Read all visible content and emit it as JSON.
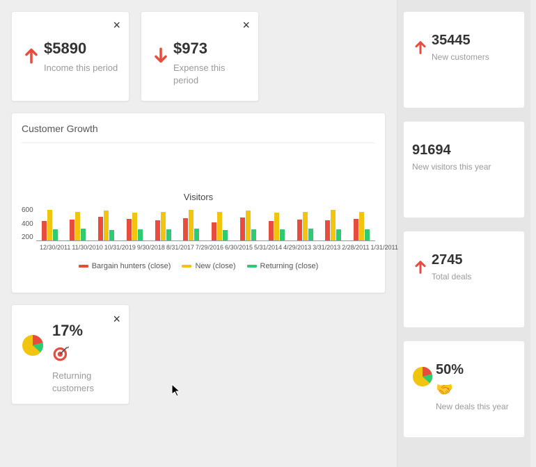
{
  "top_cards": {
    "income": {
      "value": "$5890",
      "label": "Income this period",
      "direction": "up",
      "closable": true
    },
    "expense": {
      "value": "$973",
      "label": "Expense this period",
      "direction": "down",
      "closable": true
    }
  },
  "growth": {
    "title": "Customer Growth"
  },
  "chart_data": {
    "type": "bar",
    "title": "Visitors",
    "ylim": [
      0,
      700
    ],
    "y_ticks": [
      600,
      400,
      200
    ],
    "categories": [
      "12/30/2011",
      "11/30/2010",
      "10/31/2019",
      "9/30/2018",
      "8/31/2017",
      "7/29/2016",
      "6/30/2015",
      "5/31/2014",
      "4/29/2013",
      "3/31/2013",
      "2/28/2011",
      "1/31/2011"
    ],
    "series": [
      {
        "name": "Bargain hunters (close)",
        "color": "#e74c3c",
        "values": [
          390,
          420,
          480,
          430,
          400,
          450,
          370,
          460,
          390,
          420,
          410,
          430
        ]
      },
      {
        "name": "New (close)",
        "color": "#f1c40f",
        "values": [
          620,
          570,
          600,
          560,
          580,
          610,
          570,
          600,
          560,
          580,
          620,
          570
        ]
      },
      {
        "name": "Returning (close)",
        "color": "#2ecc71",
        "values": [
          220,
          240,
          210,
          230,
          220,
          240,
          210,
          230,
          220,
          240,
          220,
          230
        ]
      }
    ]
  },
  "returning_card": {
    "value": "17%",
    "label": "Returning customers",
    "icon": "target-icon",
    "closable": true
  },
  "sidebar": {
    "items": [
      {
        "id": "new-customers",
        "value": "35445",
        "label": "New customers",
        "icon": "arrow-up"
      },
      {
        "id": "new-visitors",
        "value": "91694",
        "label": "New visitors this year",
        "icon": null
      },
      {
        "id": "total-deals",
        "value": "2745",
        "label": "Total deals",
        "icon": "arrow-up"
      },
      {
        "id": "new-deals",
        "value": "50%",
        "label": "New deals this year",
        "icon": "pie",
        "secondary_icon": "handshake-icon"
      }
    ]
  },
  "colors": {
    "up": "#e74c3c",
    "down": "#e74c3c",
    "accent_red": "#e74c3c",
    "accent_yellow": "#f1c40f",
    "accent_green": "#2ecc71"
  }
}
